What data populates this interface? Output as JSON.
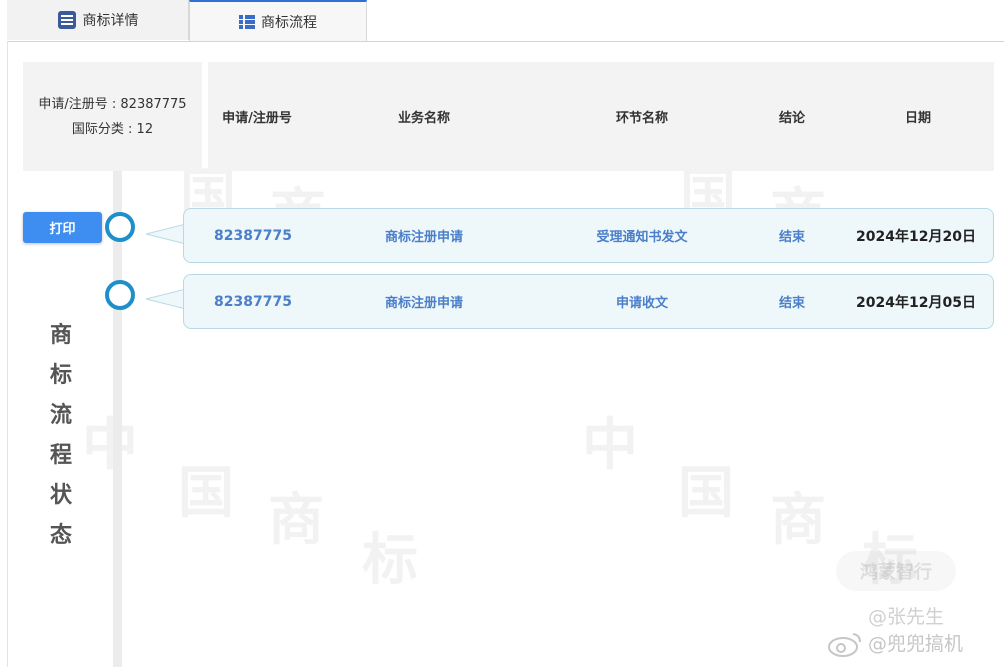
{
  "tabs": [
    {
      "label": "商标详情",
      "icon": "details-list-icon",
      "active": false
    },
    {
      "label": "商标流程",
      "icon": "flow-list-icon",
      "active": true
    }
  ],
  "registration": {
    "number_line": "申请/注册号 : 82387775",
    "class_line": "国际分类 : 12"
  },
  "table": {
    "headers": [
      "申请/注册号",
      "业务名称",
      "环节名称",
      "结论",
      "日期"
    ],
    "rows": [
      {
        "reg_no": "82387775",
        "business": "商标注册申请",
        "step": "受理通知书发文",
        "result": "结束",
        "date": "2024年12月20日"
      },
      {
        "reg_no": "82387775",
        "business": "商标注册申请",
        "step": "申请收文",
        "result": "结束",
        "date": "2024年12月05日"
      }
    ]
  },
  "print_label": "打印",
  "timeline_title": "商标流程状态",
  "watermark": {
    "brand": "鸿蒙智行",
    "weibo_line1": "@张先生",
    "weibo_line2": "@兜兜搞机"
  },
  "colors": {
    "accent_blue": "#3d8ef0",
    "timeline_dot": "#1e8fc9",
    "row_bg": "#eef7fa",
    "link_text": "#4b7fc9"
  }
}
